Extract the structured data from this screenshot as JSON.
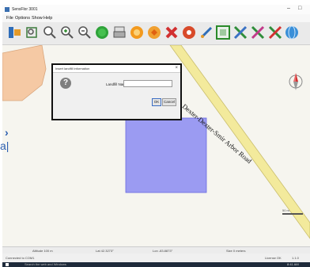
{
  "window": {
    "title": "SensFlor 3001",
    "minimize_glyph": "–",
    "maximize_glyph": "□"
  },
  "menu": {
    "items": [
      "File",
      "Options",
      "Show",
      "Help"
    ]
  },
  "toolbar": {
    "icons": [
      "upload-icon",
      "zoom-extent-icon",
      "zoom-in-icon",
      "zoom-area-icon",
      "zoom-out-icon",
      "start-icon",
      "print-icon",
      "rate-icon",
      "add-point-icon",
      "delete-icon",
      "locate-icon",
      "draw-icon",
      "grid-icon",
      "grid-export-icon",
      "grid-color-icon",
      "map-layer-icon"
    ]
  },
  "map": {
    "road_label": "Dexter-Dexter-Smir Arbor Road",
    "left_label": "a|",
    "colors": {
      "background": "#f6f5ef",
      "parcel": "#f5c9a4",
      "square": "#9b9bf2",
      "road": "#f3ea9c",
      "road_edge": "#c9bd6c"
    },
    "scale_text": "50 m"
  },
  "dialog": {
    "title": "Insert landfill information",
    "close_glyph": "×",
    "icon_glyph": "?",
    "field_label": "Landfill Name:",
    "field_value": "",
    "ok_label": "OK",
    "cancel_label": "Cancel"
  },
  "statusbar": {
    "altitude": "Altitude   100 m",
    "lat": "Lat 42.3273°",
    "lon": "Lon -83.8873°",
    "size": "Size   0 meters"
  },
  "connbar": {
    "connected": "Connected to COM1",
    "license": "License OK",
    "version": "1.1.0"
  },
  "taskbar": {
    "search_placeholder": "Search the web and Windows",
    "clock": "8:41 AM"
  }
}
